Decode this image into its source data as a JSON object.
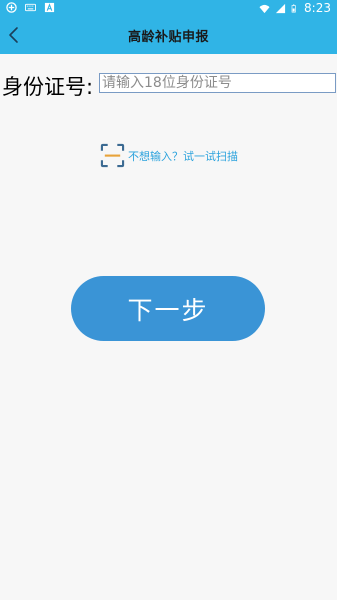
{
  "status_bar": {
    "time": "8:23",
    "left_icons": [
      "app-notification-icon",
      "keyboard-icon",
      "font-icon"
    ],
    "right_icons": [
      "wifi-icon",
      "cellular-signal-icon",
      "battery-icon"
    ]
  },
  "app_bar": {
    "title": "高龄补贴申报",
    "back_icon": "chevron-left-icon"
  },
  "form": {
    "id_label": "身份证号:",
    "id_placeholder": "请输入18位身份证号",
    "id_value": ""
  },
  "scan": {
    "icon": "scan-icon",
    "text": "不想输入？试一试扫描"
  },
  "actions": {
    "next_label": "下一步"
  },
  "colors": {
    "header_bg": "#30b4e6",
    "button_bg": "#3a94d6",
    "scan_text": "#2ca3dd",
    "page_bg": "#f7f7f7"
  }
}
